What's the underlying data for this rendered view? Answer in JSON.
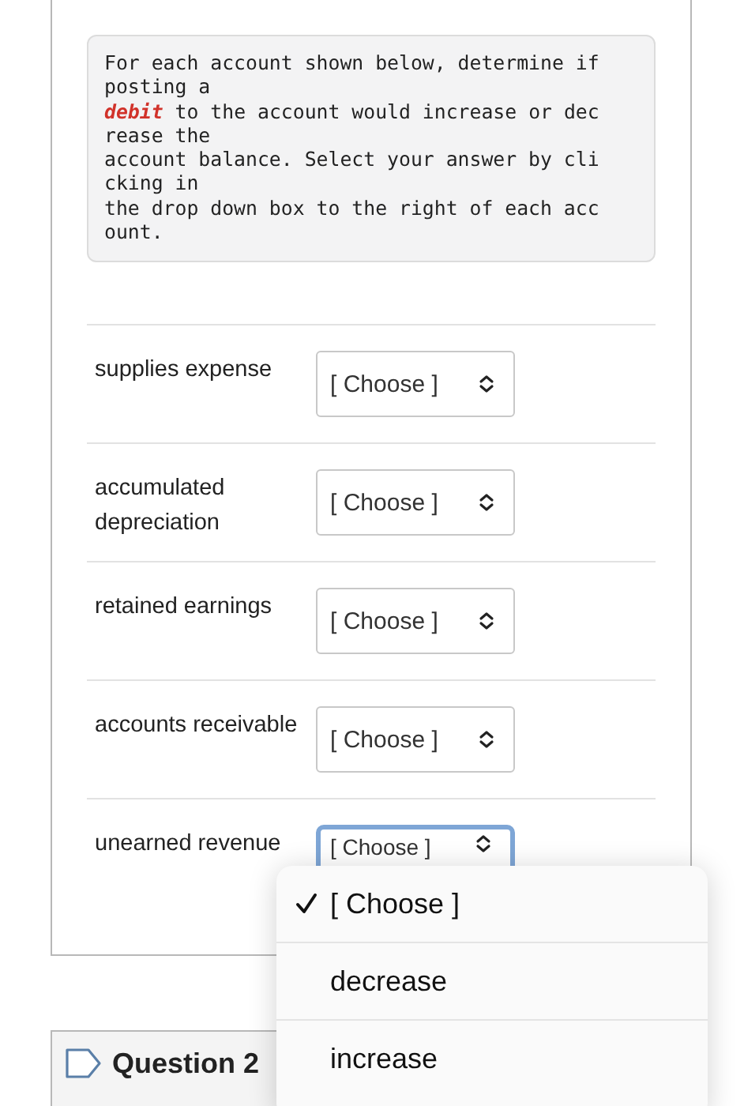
{
  "instructions": "For each account shown below, determine if\nposting a\n**debit** to the account would increase or dec\nrease the\naccount balance. Select your answer by cli\ncking in\nthe drop down box to the right of each acc\nount.",
  "rows": [
    {
      "account": "supplies expense",
      "value": "[ Choose ]",
      "focused": false
    },
    {
      "account": "accumulated depreciation",
      "value": "[ Choose ]",
      "focused": false
    },
    {
      "account": "retained earnings",
      "value": "[ Choose ]",
      "focused": false
    },
    {
      "account": "accounts receivable",
      "value": "[ Choose ]",
      "focused": false
    },
    {
      "account": "unearned revenue",
      "value": "[ Choose ]",
      "focused": true
    }
  ],
  "dropdown": {
    "options": [
      {
        "label": "[ Choose ]",
        "selected": true
      },
      {
        "label": "decrease",
        "selected": false
      },
      {
        "label": "increase",
        "selected": false
      }
    ]
  },
  "next_question": {
    "title": "Question 2"
  }
}
